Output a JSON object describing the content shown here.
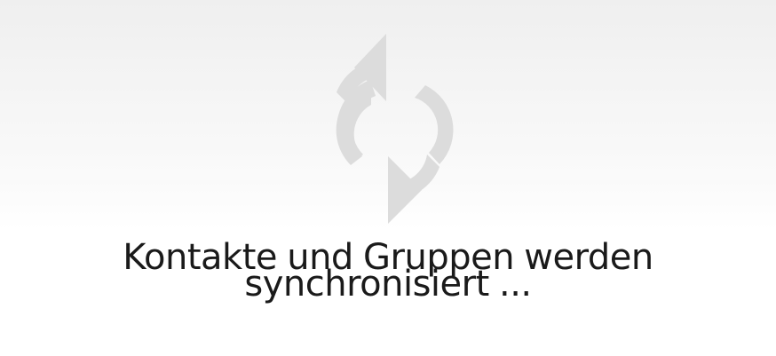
{
  "sync": {
    "icon": "sync-refresh-icon",
    "icon_color": "#dcdcdc",
    "message_line_1": "Kontakte und Gruppen werden",
    "message_line_2": "synchronisiert ..."
  }
}
